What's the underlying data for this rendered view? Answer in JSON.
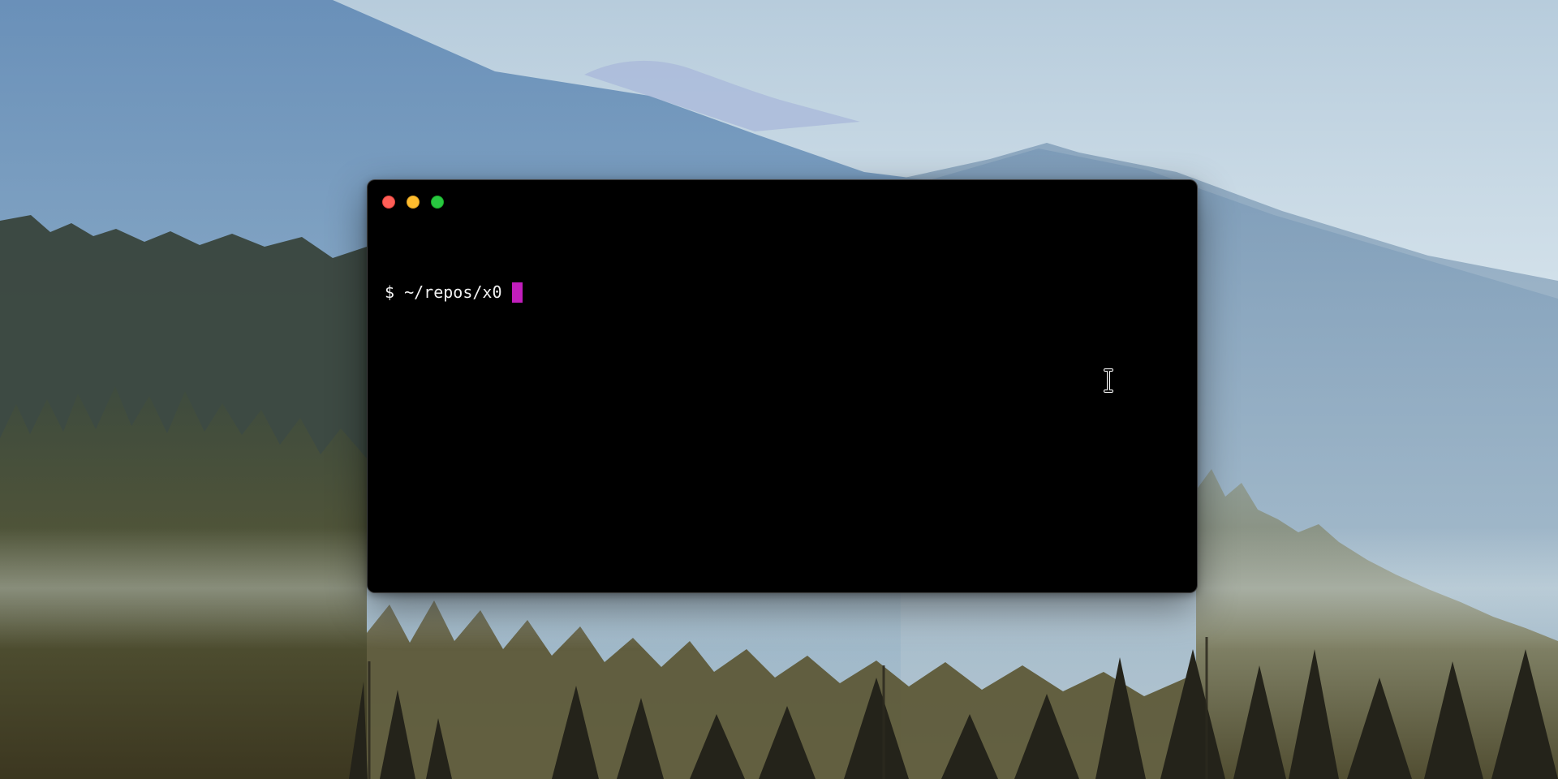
{
  "terminal": {
    "prompt_symbol": "$",
    "path": "~/repos/x0"
  },
  "colors": {
    "terminal_background": "#000000",
    "text": "#f2f2f2",
    "cursor": "#c21ebd",
    "close": "#ff5f57",
    "minimize": "#febc2e",
    "zoom": "#28c840"
  },
  "icons": {
    "close": "close-dot-icon",
    "minimize": "minimize-dot-icon",
    "zoom": "zoom-dot-icon",
    "mouse_pointer": "text-cursor-icon"
  }
}
